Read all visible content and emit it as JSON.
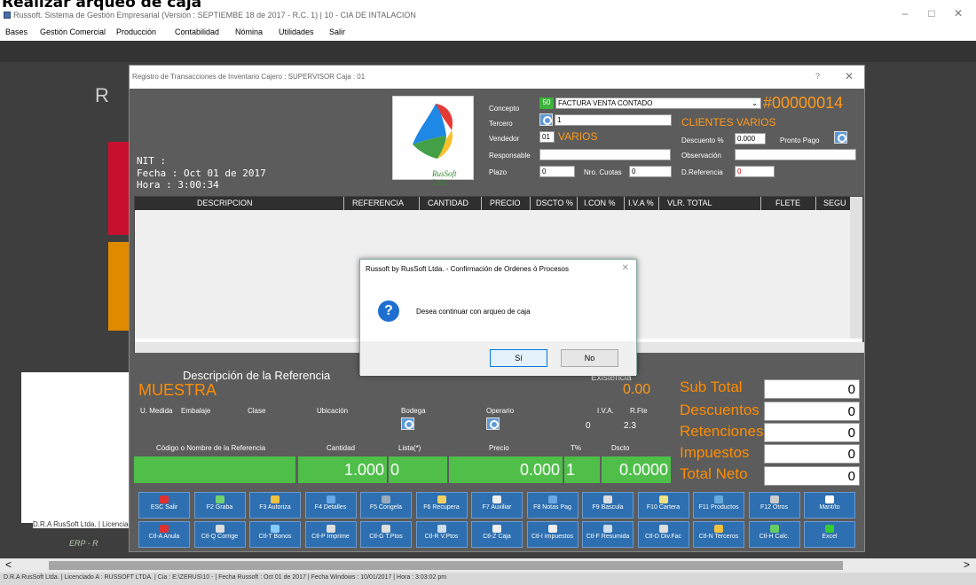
{
  "page_title": "Realizar arqueo de caja",
  "window": {
    "title": "Russoft. Sistema de Gestión Empresarial (Versión : SEPTIEMBE 18 de 2017 - R.C. 1) | 10 - CIA DE INTALACION",
    "minimize": "–",
    "maximize": "□",
    "close": "✕"
  },
  "menu": [
    "Bases",
    "Gestión Comercial",
    "Producción",
    "Contabilidad",
    "Nómina",
    "Utilidades",
    "Salir"
  ],
  "background": {
    "logo_text": "R",
    "left_label": "D.R.A RusSoft Ltda. | Licenciado",
    "left_label2": "ERP - R"
  },
  "dialog": {
    "title": "Registro de Transacciones de Inventario   Cajero : SUPERVISOR   Caja : 01",
    "help": "?",
    "close": "✕",
    "logo_caption": "RusSoft Ltda.",
    "nit_label": "NIT :",
    "fecha": "Fecha : Oct 01 de 2017",
    "hora": "Hora  : 3:00:34",
    "concepto_label": "Concepto",
    "concepto_code": "50",
    "concepto_value": "FACTURA VENTA CONTADO",
    "doc_number": "#00000014",
    "tercero_label": "Tercero",
    "tercero_value": "1",
    "tercero_name": "CLIENTES VARIOS",
    "vendedor_label": "Vendedor",
    "vendedor_code": "01",
    "vendedor_name": "VARIOS",
    "descuento_label": "Descuento %",
    "descuento_value": "0.000",
    "pronto_pago_label": "Pronto Pago",
    "responsable_label": "Responsable",
    "observacion_label": "Observación",
    "plazo_label": "Plazo",
    "plazo_value": "0",
    "cuotas_label": "Nro. Cuotas",
    "cuotas_value": "0",
    "dref_label": "D.Referencia",
    "dref_value": "0"
  },
  "grid": {
    "columns": [
      "DESCRIPCION",
      "REFERENCIA",
      "CANTIDAD",
      "PRECIO",
      "DSCTO %",
      "I.CON %",
      "I.V.A %",
      "VLR. TOTAL",
      "FLETE",
      "SEGU"
    ]
  },
  "reference": {
    "title": "Descripción de la Referencia",
    "name": "MUESTRA",
    "existencia_label": "Existencia",
    "existencia_value": "0.00",
    "medida_label": "U. Medida",
    "embalaje_label": "Embalaje",
    "clase_label": "Clase",
    "ubicacion_label": "Ubicación",
    "bodega_label": "Bodega",
    "operario_label": "Operario",
    "iva_label": "I.V.A.",
    "rfte_label": "R.Fte",
    "iva_value": "0",
    "rfte_value": "2.3",
    "codigo_label": "Código o Nombre de la Referencia",
    "cantidad_label": "Cantidad",
    "lista_label": "Lista(*)",
    "precio_label": "Precio",
    "t_label": "T%",
    "dscto_label": "Dscto",
    "cantidad_value": "1.000",
    "lista_value": "0",
    "precio_value": "0.000",
    "t_value": "1",
    "dscto_value": "0.0000"
  },
  "totals": [
    {
      "label": "Sub Total",
      "value": "0"
    },
    {
      "label": "Descuentos",
      "value": "0"
    },
    {
      "label": "Retenciones",
      "value": "0"
    },
    {
      "label": "Impuestos",
      "value": "0"
    },
    {
      "label": "Total Neto",
      "value": "0"
    }
  ],
  "buttons_row1": [
    {
      "label": "ESC Salir",
      "icon": "exit-icon",
      "color": "#e03030"
    },
    {
      "label": "F2 Graba",
      "icon": "check-icon",
      "color": "#6fd46f"
    },
    {
      "label": "F3 Autoriza",
      "icon": "lock-icon",
      "color": "#f0c040"
    },
    {
      "label": "F4 Detalles",
      "icon": "list-icon",
      "color": "#6aa8e8"
    },
    {
      "label": "F5 Congela",
      "icon": "freeze-icon",
      "color": "#9ab"
    },
    {
      "label": "F6 Recupera",
      "icon": "recover-icon",
      "color": "#f0d060"
    },
    {
      "label": "F7 Auxiliar",
      "icon": "document-icon",
      "color": "#eee"
    },
    {
      "label": "F8 Notas Pag",
      "icon": "notes-icon",
      "color": "#6aa8e8"
    },
    {
      "label": "F9 Bascula",
      "icon": "scale-icon",
      "color": "#ddd"
    },
    {
      "label": "F10 Cartera",
      "icon": "folder-icon",
      "color": "#f0e080"
    },
    {
      "label": "F11 Productos",
      "icon": "products-icon",
      "color": "#6ad"
    },
    {
      "label": "F12 Otros",
      "icon": "others-icon",
      "color": "#ccc"
    },
    {
      "label": "Mant/to",
      "icon": "search-icon",
      "color": "#fff"
    }
  ],
  "buttons_row2": [
    {
      "label": "Ctl-A Anula",
      "icon": "cancel-icon",
      "color": "#e03030"
    },
    {
      "label": "Ctl-Q Corrige",
      "icon": "edit-icon",
      "color": "#ddd"
    },
    {
      "label": "Ctl-T Bonos",
      "icon": "bonus-icon",
      "color": "#8cf"
    },
    {
      "label": "Ctl-P Imprime",
      "icon": "print-icon",
      "color": "#ddd"
    },
    {
      "label": "Ctl-G T.Ptos",
      "icon": "points-icon",
      "color": "#ddd"
    },
    {
      "label": "Ctl-R V.Ptos",
      "icon": "view-points-icon",
      "color": "#cde"
    },
    {
      "label": "Ctl-Z Caja",
      "icon": "cashbox-icon",
      "color": "#eee"
    },
    {
      "label": "Ctl-I Impuestos",
      "icon": "tax-icon",
      "color": "#eee"
    },
    {
      "label": "Ctl-F Resumida",
      "icon": "summary-icon",
      "color": "#cde"
    },
    {
      "label": "Ctl-D Div.Fac",
      "icon": "split-icon",
      "color": "#ddd"
    },
    {
      "label": "Ctl-N Terceros",
      "icon": "people-icon",
      "color": "#f0c040"
    },
    {
      "label": "Ctl-H Calc.",
      "icon": "calculator-icon",
      "color": "#6c6"
    },
    {
      "label": "Excel",
      "icon": "excel-icon",
      "color": "#3c3"
    }
  ],
  "modal": {
    "title": "Russoft by RusSoft Ltda. - Confirmación de Ordenes ó Procesos",
    "close": "✕",
    "message": "Desea continuar con arqueo de caja",
    "icon_glyph": "?",
    "yes": "Sí",
    "no": "No"
  },
  "status_bar": "D.R.A RusSoft Ltda. | Licenciado A : RUSSOFT LTDA.  | Cia : E:\\ZERUS\\10 -  | Fecha Russoft : Oct 01 de 2017 | Fecha Windows : 10/01/2017  | Hora : 3:03:02 pm"
}
